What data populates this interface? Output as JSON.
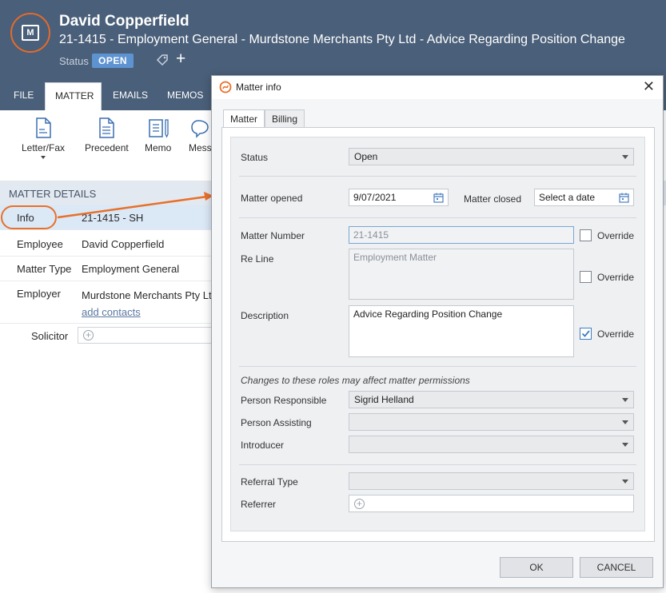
{
  "header": {
    "client_name": "David Copperfield",
    "matter_title": "21-1415 - Employment General - Murdstone Merchants Pty Ltd - Advice Regarding Position Change",
    "status_label": "Status",
    "status_value": "OPEN",
    "logo_letter": "M"
  },
  "tabs": [
    "FILE",
    "MATTER",
    "EMAILS",
    "MEMOS"
  ],
  "ribbon": [
    {
      "label": "Letter/Fax",
      "icon": "letter-icon"
    },
    {
      "label": "Precedent",
      "icon": "document-icon"
    },
    {
      "label": "Memo",
      "icon": "memo-icon"
    },
    {
      "label": "Mess",
      "icon": "message-icon"
    }
  ],
  "matter_details": {
    "heading": "MATTER DETAILS",
    "rows": [
      {
        "key": "Info",
        "value": "21-1415 - SH"
      },
      {
        "key": "Employee",
        "value": "David Copperfield"
      },
      {
        "key": "Matter Type",
        "value": "Employment General"
      },
      {
        "key": "Employer",
        "value": "Murdstone Merchants Pty Lt",
        "link": "add contacts"
      },
      {
        "key": "Solicitor",
        "value": ""
      }
    ]
  },
  "dialog": {
    "title": "Matter info",
    "tabs": [
      "Matter",
      "Billing"
    ],
    "status": {
      "label": "Status",
      "value": "Open"
    },
    "matter_opened": {
      "label": "Matter opened",
      "value": "9/07/2021"
    },
    "matter_closed": {
      "label": "Matter closed",
      "placeholder": "Select a date"
    },
    "matter_number": {
      "label": "Matter Number",
      "value": "21-1415",
      "override": "Override",
      "checked": false
    },
    "re_line": {
      "label": "Re Line",
      "value": "Employment Matter",
      "override": "Override",
      "checked": false
    },
    "description": {
      "label": "Description",
      "value": "Advice Regarding Position Change",
      "override": "Override",
      "checked": true
    },
    "roles_hint": "Changes to these roles may affect matter permissions",
    "person_responsible": {
      "label": "Person Responsible",
      "value": "Sigrid Helland"
    },
    "person_assisting": {
      "label": "Person Assisting",
      "value": ""
    },
    "introducer": {
      "label": "Introducer",
      "value": ""
    },
    "referral_type": {
      "label": "Referral Type",
      "value": ""
    },
    "referrer": {
      "label": "Referrer",
      "value": ""
    },
    "ok_label": "OK",
    "cancel_label": "CANCEL"
  },
  "colors": {
    "header_bg": "#4a5f79",
    "accent_orange": "#e8702a",
    "status_badge": "#5e93d1",
    "link": "#5a78a0"
  }
}
